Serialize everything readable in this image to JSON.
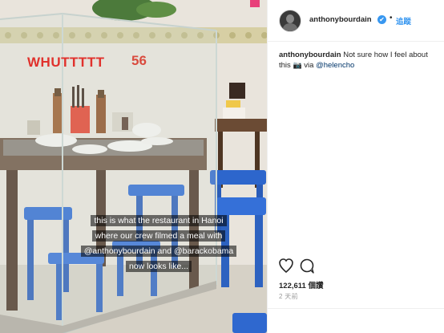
{
  "photo": {
    "sticker_text": "WHUTTTTT",
    "sign_number": "56",
    "story_lines": [
      "this is what the restaurant in Hanoi",
      "where our crew filmed a meal with",
      "@anthonybourdain and @barackobama",
      "now looks like..."
    ]
  },
  "post": {
    "username": "anthonybourdain",
    "verified_glyph": "✔",
    "separator": "•",
    "follow_label": "追蹤",
    "caption_user": "anthonybourdain",
    "caption_text": "Not sure how I feel about this",
    "caption_camera_glyph": "📷",
    "caption_via": "via",
    "caption_mention": "@helencho",
    "likes": "122,611 個讚",
    "time_ago": "2 天前"
  },
  "colors": {
    "link_blue": "#3897f0",
    "sticker_red": "#e0312c",
    "stool_blue": "#2c63c8"
  },
  "icons": [
    "heart-icon",
    "comment-icon",
    "verified-badge-icon",
    "camera-icon"
  ]
}
